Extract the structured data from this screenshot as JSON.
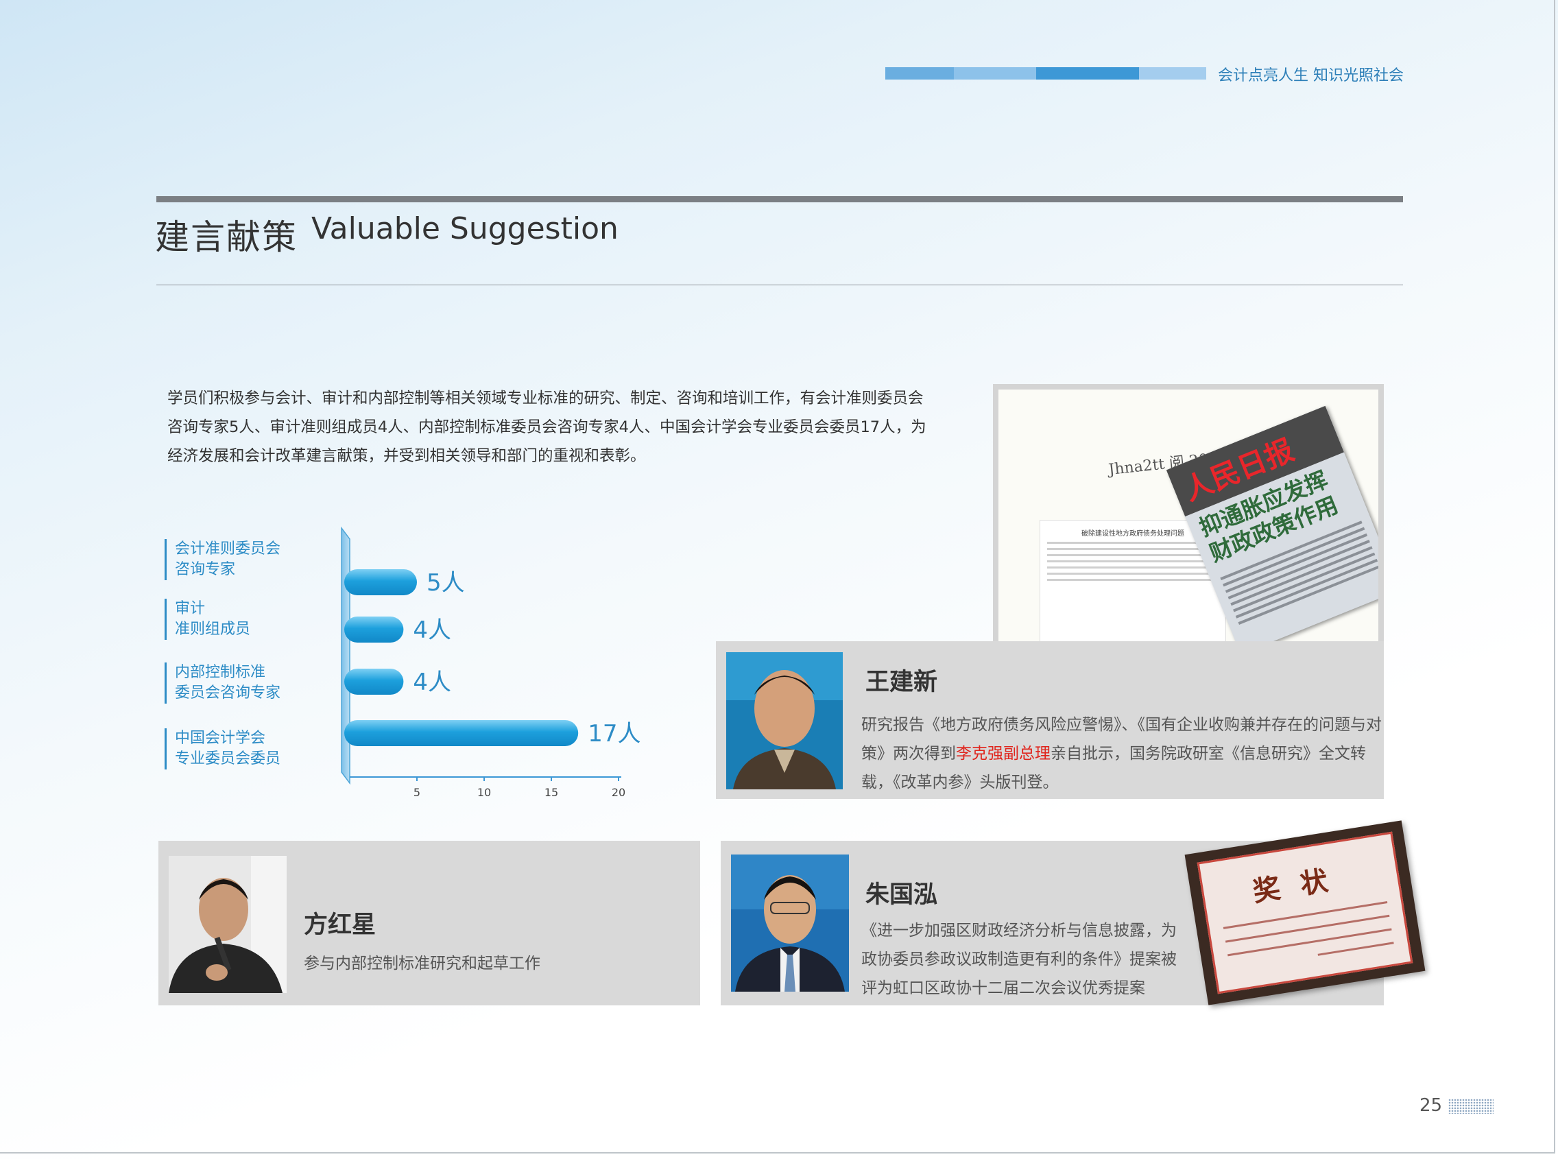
{
  "header": {
    "tagline": "会计点亮人生 知识光照社会",
    "accent_colors": [
      "#6aaee0",
      "#8dc2ea",
      "#3d98d6",
      "#a4cdee"
    ]
  },
  "title": {
    "cn": "建言献策",
    "en": "Valuable Suggestion"
  },
  "intro": "学员们积极参与会计、审计和内部控制等相关领域专业标准的研究、制定、咨询和培训工作，有会计准则委员会咨询专家5人、审计准则组成员4人、内部控制标准委员会咨询专家4人、中国会计学会专业委员会委员17人，为经济发展和会计改革建言献策，并受到相关领导和部门的重视和表彰。",
  "chart_data": {
    "type": "bar",
    "orientation": "horizontal",
    "categories": [
      [
        "会计准则委员会",
        "咨询专家"
      ],
      [
        "审计",
        "准则组成员"
      ],
      [
        "内部控制标准",
        "委员会咨询专家"
      ],
      [
        "中国会计学会",
        "专业委员会委员"
      ]
    ],
    "values": [
      5,
      4,
      4,
      17
    ],
    "value_labels": [
      "5人",
      "4人",
      "4人",
      "17人"
    ],
    "xticks": [
      5,
      10,
      15,
      20
    ],
    "xlim": [
      0,
      20
    ],
    "color": "#1da0dd"
  },
  "newspaper": {
    "signature": "Jhna2tt 阅 2014",
    "doc_title": "破除建设性地方政府债务处理问题",
    "headline": "人民日报",
    "subheadline": "抑通胀应发挥财政政策作用"
  },
  "people": [
    {
      "name": "王建新",
      "desc_before": "研究报告《地方政府债务风险应警惕》、《国有企业收购兼并存在的问题与对策》两次得到",
      "desc_highlight": "李克强副总理",
      "desc_after": "亲自批示，国务院政研室《信息研究》全文转载，《改革内参》头版刊登。"
    },
    {
      "name": "方红星",
      "desc": "参与内部控制标准研究和起草工作"
    },
    {
      "name": "朱国泓",
      "desc": "《进一步加强区财政经济分析与信息披露，为政协委员参政议政制造更有利的条件》提案被评为虹口区政协十二届二次会议优秀提案"
    }
  ],
  "award": {
    "title": "奖状"
  },
  "page_number": "25"
}
